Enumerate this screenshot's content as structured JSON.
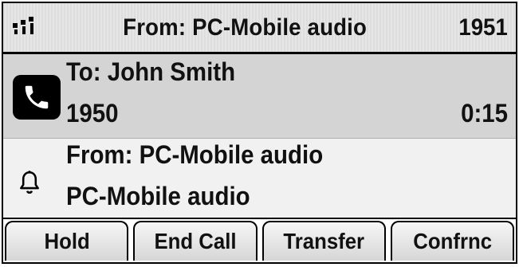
{
  "header": {
    "title": "From: PC-Mobile audio",
    "extension": "1951",
    "signal_icon": "signal-strength-icon"
  },
  "active_call": {
    "to_label": "To: John Smith",
    "number": "1950",
    "duration": "0:15",
    "icon": "handset-icon"
  },
  "incoming_call": {
    "from_label": "From: PC-Mobile audio",
    "caller_name": "PC-Mobile audio",
    "icon": "bell-icon"
  },
  "softkeys": [
    {
      "label": "Hold"
    },
    {
      "label": "End Call"
    },
    {
      "label": "Transfer"
    },
    {
      "label": "Confrnc"
    }
  ],
  "colors": {
    "header_bg": "#e6e6e6",
    "active_bg": "#d4d4d4",
    "incoming_bg": "#f1f1f1"
  }
}
